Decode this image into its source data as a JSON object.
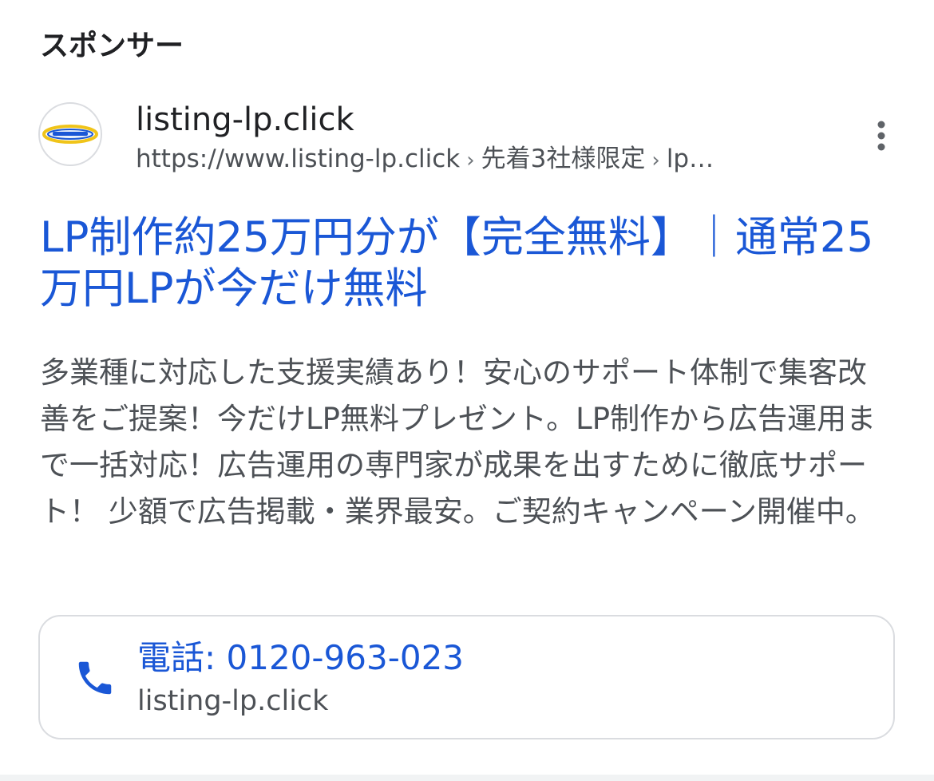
{
  "ad": {
    "sponsor_label": "スポンサー",
    "site_name": "listing-lp.click",
    "url": {
      "base": "https://www.listing-lp.click",
      "separator": "›",
      "crumb1": "先着3社様限定",
      "crumb2": "lp…"
    },
    "more_icon": "more-vert-icon",
    "title": "LP制作約25万円分が【完全無料】｜通常25万円LPが今だけ無料",
    "description": "多業種に対応した支援実績あり！安心のサポート体制で集客改善をご提案！今だけLP無料プレゼント。LP制作から広告運用まで一括対応！広告運用の専門家が成果を出すために徹底サポート！ 少額で広告掲載・業界最安。ご契約キャンペーン開催中。",
    "call_extension": {
      "icon": "phone-icon",
      "label": "電話: 0120-963-023",
      "domain": "listing-lp.click"
    }
  },
  "colors": {
    "title_blue": "#1a57d6",
    "text_dark": "#202124",
    "text_gray": "#4d5156",
    "border": "#dadce0"
  }
}
